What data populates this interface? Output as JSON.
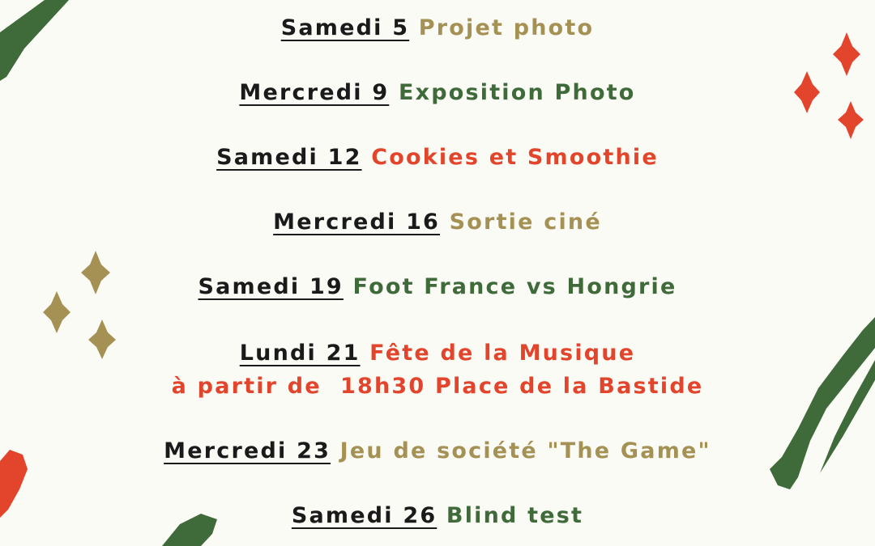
{
  "colors": {
    "background": "#fbfbf6",
    "day": "#1a1a1a",
    "gold": "#a59154",
    "green": "#3f6a3a",
    "red": "#e2452b"
  },
  "decorations": {
    "shapes": [
      "green-brush-stroke",
      "red-sparkle",
      "gold-sparkle",
      "red-brush-stroke"
    ]
  },
  "events": [
    {
      "day": "Samedi 5",
      "activity": "Projet photo",
      "color": "gold"
    },
    {
      "day": "Mercredi 9",
      "activity": "Exposition Photo",
      "color": "green"
    },
    {
      "day": "Samedi 12",
      "activity": "Cookies et Smoothie",
      "color": "red"
    },
    {
      "day": "Mercredi 16",
      "activity": "Sortie ciné",
      "color": "gold"
    },
    {
      "day": "Samedi 19",
      "activity": "Foot France vs Hongrie",
      "color": "green"
    },
    {
      "day": "Lundi 21",
      "activity": "Fête de la Musique",
      "detail": "à partir de  18h30 Place de la Bastide",
      "color": "red"
    },
    {
      "day": "Mercredi 23",
      "activity": "Jeu de société \"The Game\"",
      "color": "gold"
    },
    {
      "day": "Samedi 26",
      "activity": "Blind test",
      "color": "green"
    }
  ]
}
